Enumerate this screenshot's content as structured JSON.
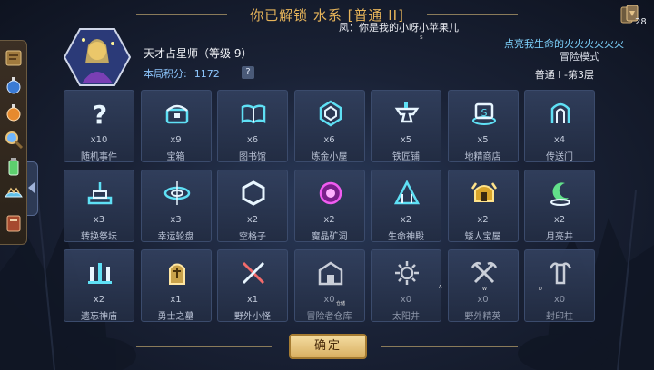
{
  "banner": {
    "title": "你已解锁 水系 [普通 II]"
  },
  "chat": {
    "line": "凤：你是我的小呀小苹果儿",
    "dot": "s"
  },
  "promo": {
    "text": "点亮我生命的火火火火火火"
  },
  "card_icon": {
    "icon": "card-stack-icon",
    "count": "28"
  },
  "sidebar": {
    "items": [
      {
        "icon": "scroll-book-icon"
      },
      {
        "icon": "blue-potion-icon"
      },
      {
        "icon": "orange-potion-icon"
      },
      {
        "icon": "magnifier-icon"
      },
      {
        "icon": "green-potion-icon"
      },
      {
        "icon": "crown-cloud-icon"
      },
      {
        "icon": "red-book-icon"
      }
    ]
  },
  "player": {
    "name": "天才占星师（等级 9）",
    "score_label": "本局积分:",
    "score_value": "1172",
    "help": "?"
  },
  "mode": {
    "label": "冒险模式",
    "floor": "普通 I -第3层"
  },
  "tiles": [
    {
      "icon": "question-icon",
      "count": "x10",
      "name": "随机事件",
      "locked": false
    },
    {
      "icon": "treasure-chest-icon",
      "count": "x9",
      "name": "宝箱",
      "locked": false
    },
    {
      "icon": "open-book-icon",
      "count": "x6",
      "name": "图书馆",
      "locked": false
    },
    {
      "icon": "alchemy-gem-icon",
      "count": "x6",
      "name": "炼金小屋",
      "locked": false
    },
    {
      "icon": "anvil-icon",
      "count": "x5",
      "name": "铁匠铺",
      "locked": false
    },
    {
      "icon": "map-shop-icon",
      "count": "x5",
      "name": "地精商店",
      "locked": false
    },
    {
      "icon": "portal-icon",
      "count": "x4",
      "name": "传送门",
      "locked": false
    },
    {
      "icon": "altar-icon",
      "count": "x3",
      "name": "转换祭坛",
      "locked": false
    },
    {
      "icon": "vortex-icon",
      "count": "x3",
      "name": "幸运轮盘",
      "locked": false
    },
    {
      "icon": "hexagon-icon",
      "count": "x2",
      "name": "空格子",
      "locked": false
    },
    {
      "icon": "magic-orb-icon",
      "count": "x2",
      "name": "魔晶矿洞",
      "locked": false
    },
    {
      "icon": "temple-icon",
      "count": "x2",
      "name": "生命神殿",
      "locked": false
    },
    {
      "icon": "dwarf-helmet-icon",
      "count": "x2",
      "name": "矮人宝屋",
      "locked": false
    },
    {
      "icon": "moon-well-icon",
      "count": "x2",
      "name": "月亮井",
      "locked": false
    },
    {
      "icon": "shrine-icon",
      "count": "x2",
      "name": "遗忘神庙",
      "locked": false
    },
    {
      "icon": "tombstone-icon",
      "count": "x1",
      "name": "勇士之墓",
      "locked": false
    },
    {
      "icon": "crossed-swords-icon",
      "count": "x1",
      "name": "野外小怪",
      "locked": false
    },
    {
      "icon": "warehouse-icon",
      "count": "x0",
      "name": "冒险者仓库",
      "locked": true
    },
    {
      "icon": "sun-icon",
      "count": "x0",
      "name": "太阳井",
      "locked": true
    },
    {
      "icon": "crossed-axes-icon",
      "count": "x0",
      "name": "野外精英",
      "locked": true
    },
    {
      "icon": "seal-pillar-icon",
      "count": "x0",
      "name": "封印柱",
      "locked": true
    }
  ],
  "tiny_marks": {
    "warehouse": "仓储",
    "sun": "A",
    "axes": "W",
    "seal": "D"
  },
  "confirm": {
    "label": "确定"
  }
}
